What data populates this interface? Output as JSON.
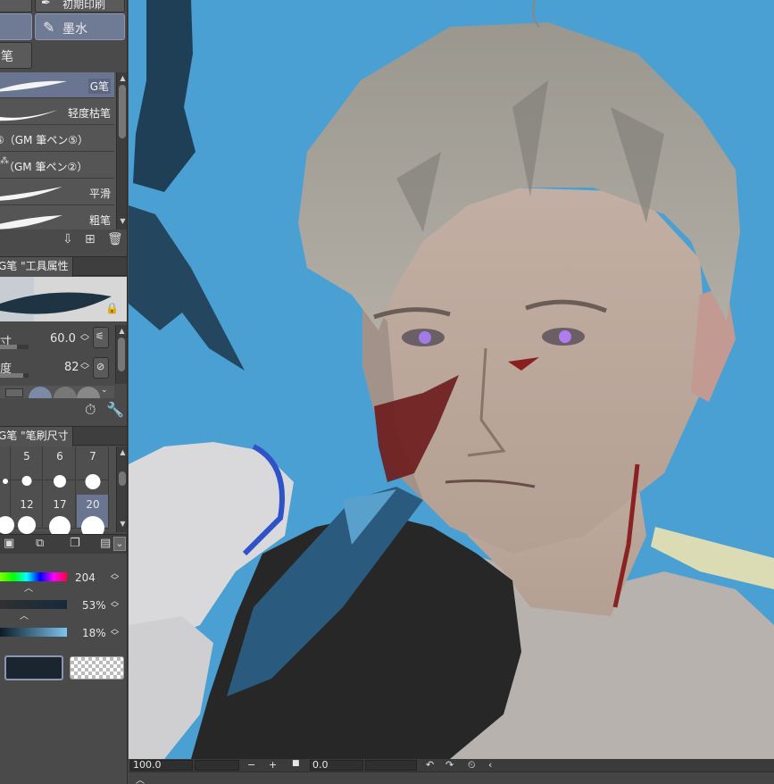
{
  "tool_buttons": {
    "top_partial_label": "初期印刷",
    "ink_label": "墨水",
    "pen_partial_label": "笔"
  },
  "brush_list": {
    "items": [
      {
        "label": "G笔",
        "selected": true
      },
      {
        "label": "轻度枯笔",
        "selected": false
      },
      {
        "label": "⑤（GM 筆ペン⑤）",
        "selected": false
      },
      {
        "label": "（GM 筆ペン②）",
        "selected": false
      },
      {
        "label": "平滑",
        "selected": false
      },
      {
        "label": "粗笔",
        "selected": false
      }
    ],
    "actions": {
      "download_icon": "download-icon",
      "duplicate_icon": "duplicate-icon",
      "trash_icon": "trash-icon"
    }
  },
  "tool_property": {
    "tab_label": "G笔 \"工具属性",
    "size_label": "寸",
    "size_value": "60.0",
    "density_label": "度",
    "density_value": "82",
    "size_fill_fraction": 0.6,
    "density_fill_fraction": 0.82
  },
  "brush_size": {
    "tab_label": "G笔 \"笔刷尺寸",
    "sizes_row1": [
      "5",
      "6",
      "7"
    ],
    "sizes_row2": [
      "12",
      "17",
      "20"
    ]
  },
  "color": {
    "hue_value": "204",
    "saturation_value": "53%",
    "brightness_value": "18%",
    "main_color": "#1a2530",
    "accent": "#7a86a5"
  },
  "status": {
    "zoom": "100.0",
    "angle": "0.0",
    "minus": "−",
    "plus": "+"
  }
}
